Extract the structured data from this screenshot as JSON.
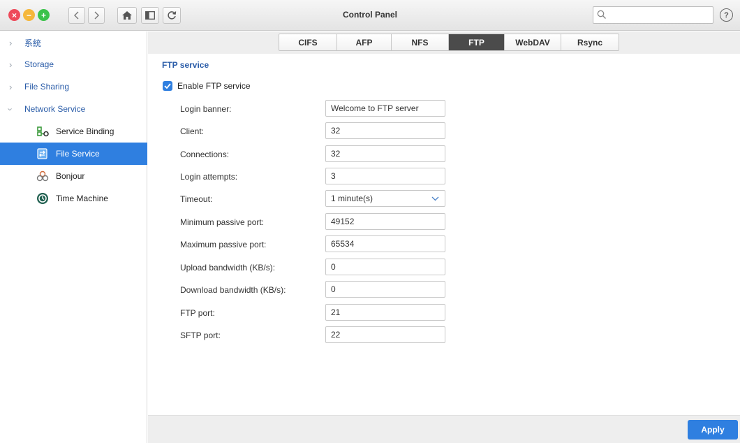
{
  "window": {
    "title": "Control Panel",
    "search_placeholder": ""
  },
  "toolbar": {
    "help_glyph": "?"
  },
  "sidebar": {
    "top_items": [
      {
        "label": "系統"
      },
      {
        "label": "Storage"
      },
      {
        "label": "File Sharing"
      },
      {
        "label": "Network Service"
      }
    ],
    "sub_items": [
      {
        "label": "Service Binding",
        "icon": "service-binding-icon"
      },
      {
        "label": "File Service",
        "icon": "file-service-icon"
      },
      {
        "label": "Bonjour",
        "icon": "bonjour-icon"
      },
      {
        "label": "Time Machine",
        "icon": "time-machine-icon"
      }
    ]
  },
  "tabs": [
    "CIFS",
    "AFP",
    "NFS",
    "FTP",
    "WebDAV",
    "Rsync"
  ],
  "active_tab": "FTP",
  "ftp": {
    "section_title": "FTP service",
    "enable_label": "Enable FTP service",
    "enabled": true,
    "fields": [
      {
        "label": "Login banner:",
        "value": "Welcome to FTP server"
      },
      {
        "label": "Client:",
        "value": "32"
      },
      {
        "label": "Connections:",
        "value": "32"
      },
      {
        "label": "Login attempts:",
        "value": "3"
      },
      {
        "label": "Timeout:",
        "value": "1 minute(s)"
      },
      {
        "label": "Minimum passive port:",
        "value": "49152"
      },
      {
        "label": "Maximum passive port:",
        "value": "65534"
      },
      {
        "label": "Upload bandwidth (KB/s):",
        "value": "0"
      },
      {
        "label": "Download bandwidth (KB/s):",
        "value": "0"
      },
      {
        "label": "FTP port:",
        "value": "21"
      },
      {
        "label": "SFTP port:",
        "value": "22"
      }
    ]
  },
  "footer": {
    "apply_label": "Apply"
  },
  "colors": {
    "accent": "#2f7fe0",
    "link": "#2a5ca8",
    "active_tab": "#4b4b4b"
  }
}
